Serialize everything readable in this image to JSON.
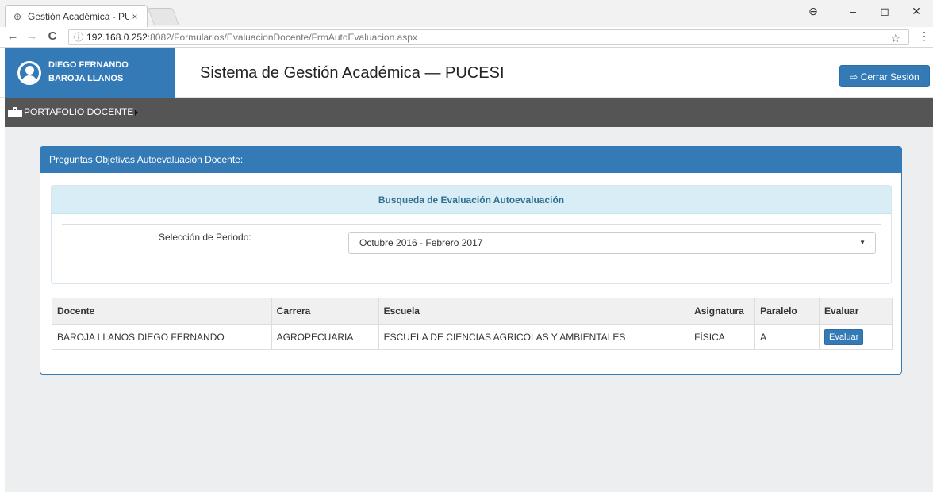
{
  "browser": {
    "tab_title": "Gestión Académica - PU",
    "tab_close": "×",
    "url_host": "192.168.0.252",
    "url_rest": ":8082/Formularios/EvaluacionDocente/FrmAutoEvaluacion.aspx",
    "info_glyph": "ⓘ",
    "back_glyph": "←",
    "forward_glyph": "→",
    "reload_glyph": "C",
    "star_glyph": "☆",
    "menu_glyph": "⋮",
    "account_glyph": "⊖",
    "minimize_glyph": "–",
    "maximize_glyph": "◻",
    "close_glyph": "✕"
  },
  "header": {
    "user_first": "DIEGO FERNANDO",
    "user_last": "BAROJA LLANOS",
    "title": "Sistema de Gestión Académica — PUCESI",
    "logout_icon": "⇨",
    "logout_label": "Cerrar Sesión"
  },
  "nav": {
    "item_label": "PORTAFOLIO DOCENTE"
  },
  "panel": {
    "heading": "Preguntas Objetivas Autoevaluación Docente:",
    "search_heading": "Busqueda de Evaluación Autoevaluación",
    "period_label": "Selección de Periodo:",
    "period_value": "Octubre 2016 - Febrero 2017",
    "select_arrow": "▼"
  },
  "table": {
    "headers": {
      "docente": "Docente",
      "carrera": "Carrera",
      "escuela": "Escuela",
      "asignatura": "Asignatura",
      "paralelo": "Paralelo",
      "evaluar": "Evaluar"
    },
    "rows": [
      {
        "docente": "BAROJA LLANOS DIEGO FERNANDO",
        "carrera": "AGROPECUARIA",
        "escuela": "ESCUELA DE CIENCIAS AGRICOLAS Y AMBIENTALES",
        "asignatura": "FÍSICA",
        "paralelo": "A",
        "action": "Evaluar"
      }
    ]
  },
  "colors": {
    "primary": "#337ab7",
    "navbar": "#555555",
    "info_bg": "#d9edf7",
    "info_text": "#31708f"
  }
}
